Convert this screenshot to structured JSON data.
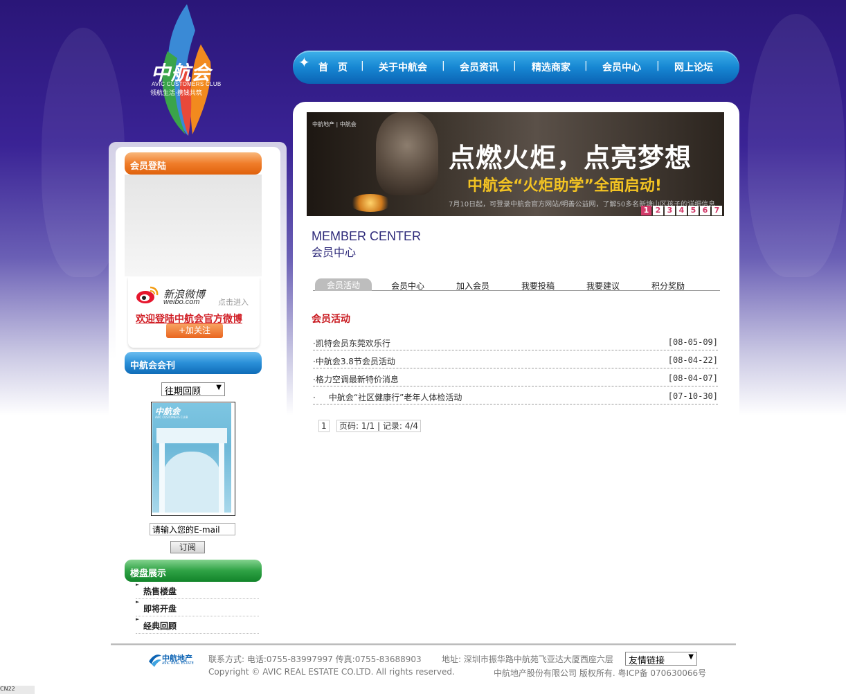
{
  "logo": {
    "name": "中航会",
    "sub": "AVIC CUSTOMERS CLUB",
    "slogan": "领航生活·携钱共筑"
  },
  "nav": {
    "items": [
      "首　页",
      "关于中航会",
      "会员资讯",
      "精选商家",
      "会员中心",
      "网上论坛"
    ],
    "separator": "|"
  },
  "banner": {
    "brand": "中航地产 | 中航会",
    "headline": "点燃火炬，点亮梦想",
    "subheadline": "中航会“火炬助学”全面启动!",
    "caption": "7月10日起，可登录中航会官方网站/明善公益网，了解50多名新塘山区孩子的详细信息",
    "pages": [
      "1",
      "2",
      "3",
      "4",
      "5",
      "6",
      "7"
    ],
    "active_page": "1"
  },
  "member_center": {
    "title_en": "MEMBER CENTER",
    "title_cn": "会员中心"
  },
  "tabs": [
    "会员活动",
    "会员中心",
    "加入会员",
    "我要投稿",
    "我要建议",
    "积分奖励"
  ],
  "section_title": "会员活动",
  "news": [
    {
      "title": "·凯特会员东莞欢乐行",
      "date": "[08-05-09]"
    },
    {
      "title": "·中航会3.8节会员活动",
      "date": "[08-04-22]"
    },
    {
      "title": "·格力空调最新特价消息",
      "date": "[08-04-07]"
    },
    {
      "title": "·     中航会“社区健康行”老年人体检活动",
      "date": "[07-10-30]"
    }
  ],
  "pager": {
    "page_link": "1",
    "info": "页码: 1/1 | 记录: 4/4"
  },
  "sidebar": {
    "login_title": "会员登陆",
    "weibo": {
      "name": "新浪微博",
      "url": "weibo.com",
      "click": "点击进入",
      "welcome": "欢迎登陆中航会官方微博",
      "follow": "+加关注"
    },
    "journal_title": "中航会会刊",
    "journal_select": "往期回顾",
    "magazine_title": "中航会",
    "magazine_sub": "AVIC CUSTOMERS CLUB",
    "email_value": "请输入您的E-mail",
    "subscribe": "订阅",
    "property_title": "楼盘展示",
    "property_items": [
      "热售楼盘",
      "即将开盘",
      "经典回顾"
    ]
  },
  "footer": {
    "logo_text": "中航地产",
    "logo_sub": "AVIC REAL ESTATE",
    "contact": "联系方式: 电话:0755-83997997 传真:0755-83688903",
    "address": "地址: 深圳市振华路中航苑飞亚达大厦西座六层",
    "links_select": "友情链接",
    "copyright": "Copyright © AVIC REAL ESTATE CO.LTD. All rights reserved.",
    "icp": "中航地产股份有限公司 版权所有. 粤ICP备 070630066号"
  },
  "corner_label": "CN22"
}
